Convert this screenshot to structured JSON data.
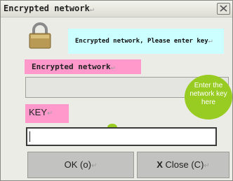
{
  "window": {
    "title": "Encrypted network",
    "close_icon": "close-x-icon"
  },
  "header": {
    "icon": "lock-icon",
    "message": "Encrypted network, Please enter key"
  },
  "network": {
    "label": "Encrypted network",
    "value": ""
  },
  "hint": {
    "text": "Enter the\nnetwork key\nhere",
    "color": "#99cc22"
  },
  "key": {
    "label": "KEY",
    "value": ""
  },
  "buttons": {
    "ok_label": "OK (o)",
    "close_label": "Close (C)",
    "close_prefix": "X"
  },
  "colors": {
    "label_bg": "#ff99cc",
    "message_bg": "#ccffff",
    "bubble": "#99cc22"
  }
}
